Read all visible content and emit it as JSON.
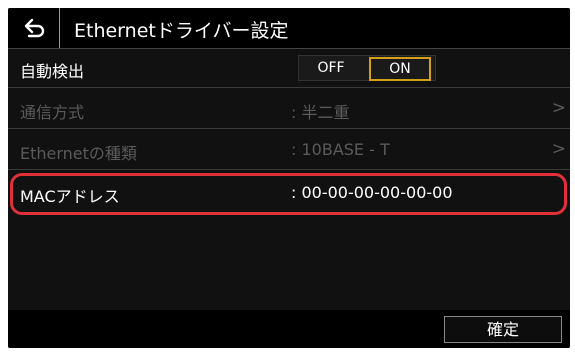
{
  "header": {
    "back_icon": "back-arrow-icon",
    "title": "Ethernetドライバー設定"
  },
  "rows": [
    {
      "label": "自動検出",
      "toggle": {
        "off": "OFF",
        "on": "ON",
        "selected": "ON"
      }
    },
    {
      "label": "通信方式",
      "value": ": 半二重",
      "disabled": true,
      "chevron": ">"
    },
    {
      "label": "Ethernetの種類",
      "value": ": 10BASE - T",
      "disabled": true,
      "chevron": ">"
    },
    {
      "label": "MACアドレス",
      "value": ": 00-00-00-00-00-00",
      "highlighted": true
    }
  ],
  "footer": {
    "confirm_label": "確定"
  },
  "colors": {
    "highlight": "#e0303a",
    "toggle_selected_border": "#d4a017",
    "disabled_text": "#5a5a5a"
  }
}
